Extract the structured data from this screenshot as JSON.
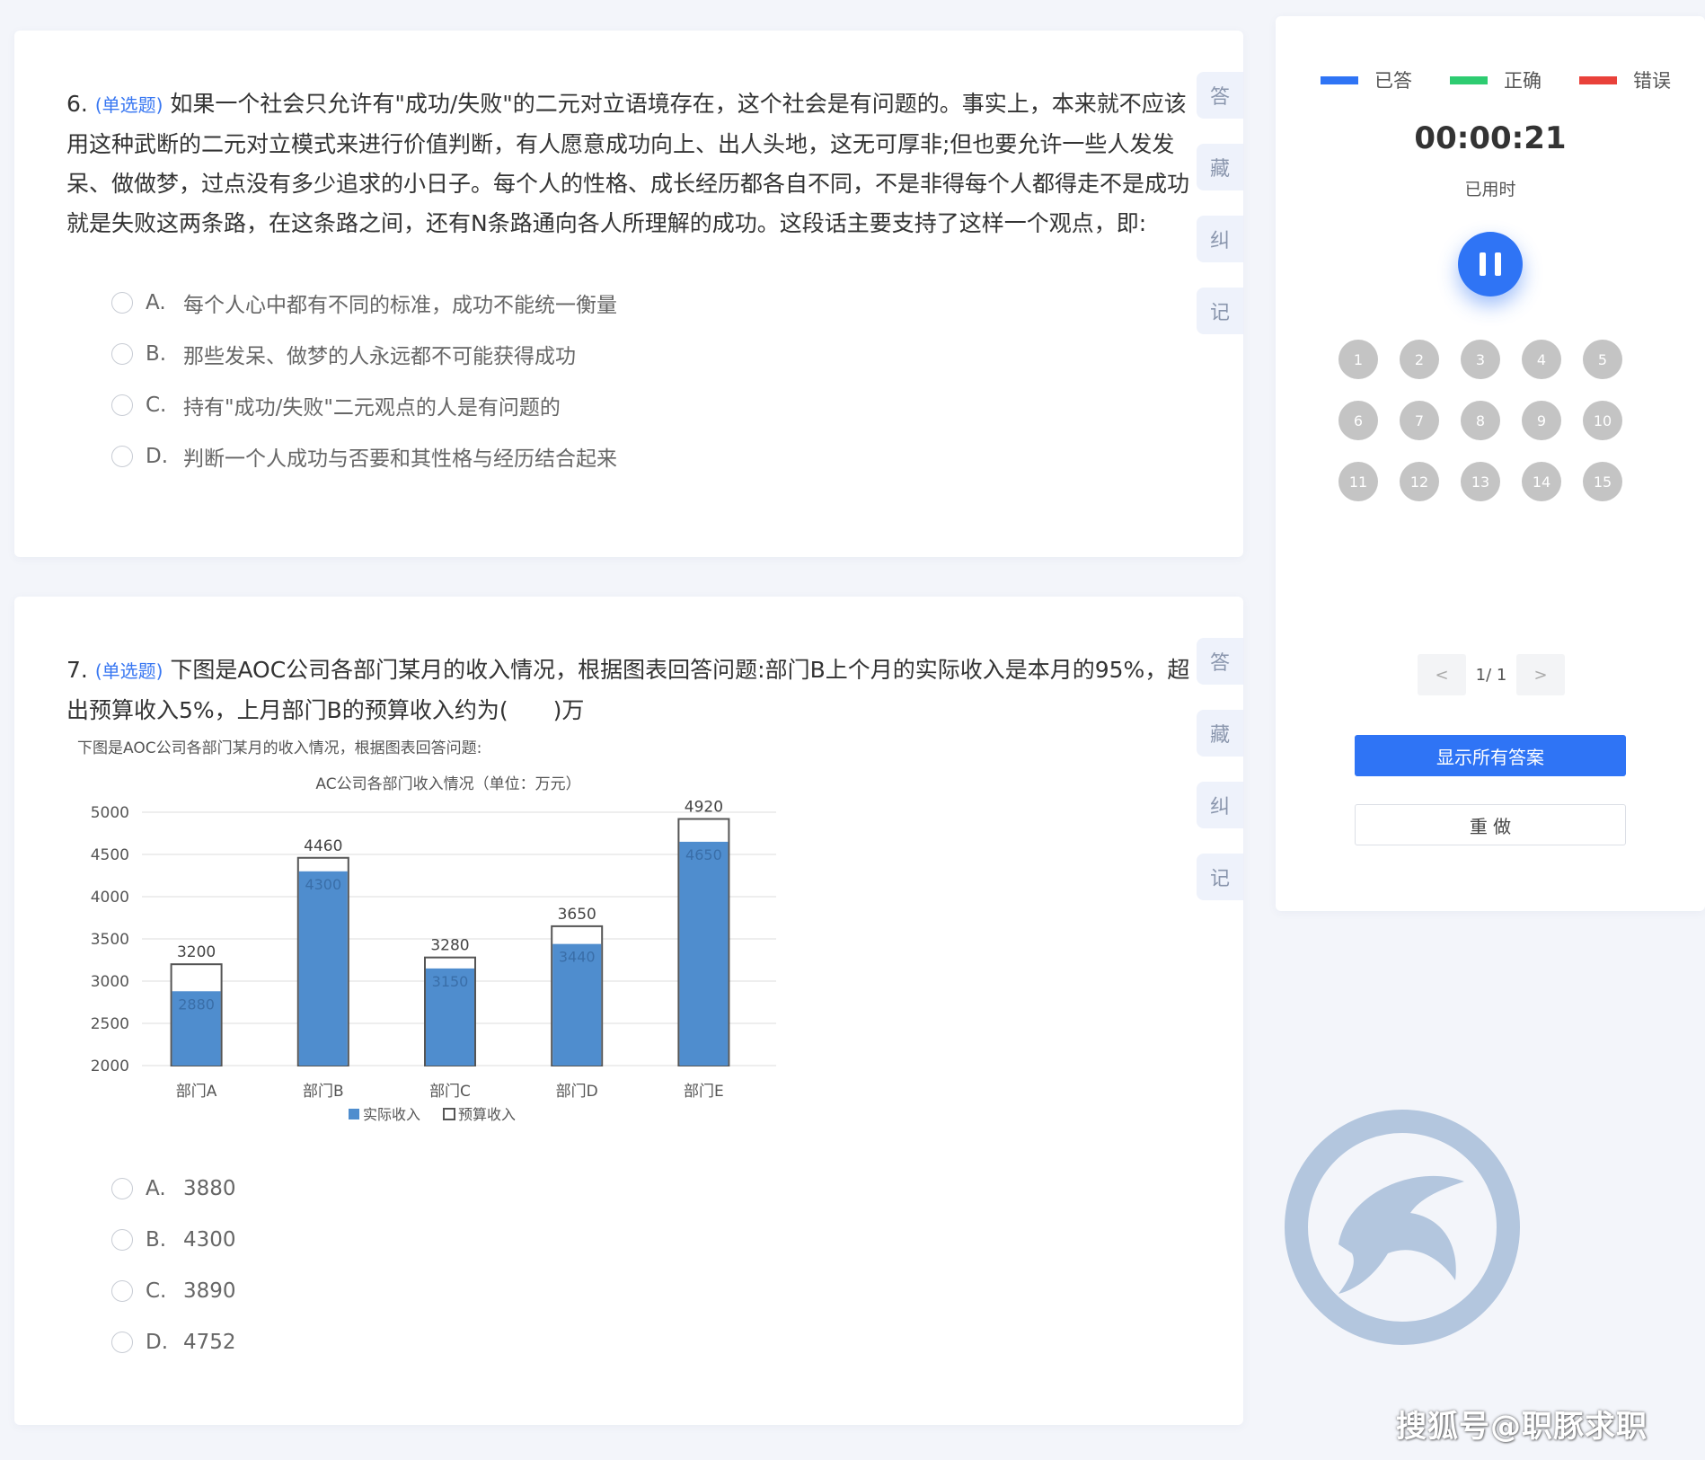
{
  "q6": {
    "number": "6.",
    "type": "(单选题)",
    "text": "如果一个社会只允许有\"成功/失败\"的二元对立语境存在，这个社会是有问题的。事实上，本来就不应该用这种武断的二元对立模式来进行价值判断，有人愿意成功向上、出人头地，这无可厚非;但也要允许一些人发发呆、做做梦，过点没有多少追求的小日子。每个人的性格、成长经历都各自不同，不是非得每个人都得走不是成功就是失败这两条路，在这条路之间，还有N条路通向各人所理解的成功。这段话主要支持了这样一个观点，即:",
    "options": [
      {
        "letter": "A.",
        "text": "每个人心中都有不同的标准，成功不能统一衡量"
      },
      {
        "letter": "B.",
        "text": "那些发呆、做梦的人永远都不可能获得成功"
      },
      {
        "letter": "C.",
        "text": "持有\"成功/失败\"二元观点的人是有问题的"
      },
      {
        "letter": "D.",
        "text": "判断一个人成功与否要和其性格与经历结合起来"
      }
    ]
  },
  "q7": {
    "number": "7.",
    "type": "(单选题)",
    "text": "下图是AOC公司各部门某月的收入情况，根据图表回答问题:部门B上个月的实际收入是本月的95%，超出预算收入5%，上月部门B的预算收入约为(　　)万",
    "options": [
      {
        "letter": "A.",
        "text": "3880"
      },
      {
        "letter": "B.",
        "text": "4300"
      },
      {
        "letter": "C.",
        "text": "3890"
      },
      {
        "letter": "D.",
        "text": "4752"
      }
    ]
  },
  "side_tabs": [
    "答",
    "藏",
    "纠",
    "记"
  ],
  "chart_data": {
    "type": "bar",
    "caption": "下图是AOC公司各部门某月的收入情况，根据图表回答问题:",
    "title": "AC公司各部门收入情况（单位：万元）",
    "categories": [
      "部门A",
      "部门B",
      "部门C",
      "部门D",
      "部门E"
    ],
    "series": [
      {
        "name": "实际收入",
        "values": [
          2880,
          4300,
          3150,
          3440,
          4650
        ]
      },
      {
        "name": "预算收入",
        "values": [
          3200,
          4460,
          3280,
          3650,
          4920
        ]
      }
    ],
    "yticks": [
      "2000",
      "2500",
      "3000",
      "3500",
      "4000",
      "4500",
      "5000"
    ],
    "ylim": [
      2000,
      5000
    ],
    "grid": true,
    "legend_position": "bottom-center",
    "colors": {
      "actual": "#4f8dce",
      "budget": "#ffffff"
    }
  },
  "sidebar": {
    "legend": [
      {
        "label": "已答",
        "color": "#2f74f5"
      },
      {
        "label": "正确",
        "color": "#2ecc71"
      },
      {
        "label": "错误",
        "color": "#e9413a"
      }
    ],
    "timer": "00:00:21",
    "timer_label": "已用时",
    "numbers": [
      "1",
      "2",
      "3",
      "4",
      "5",
      "6",
      "7",
      "8",
      "9",
      "10",
      "11",
      "12",
      "13",
      "14",
      "15"
    ],
    "pager": {
      "prev": "<",
      "text": "1/ 1",
      "next": ">"
    },
    "show_answers": "显示所有答案",
    "redo": "重 做"
  },
  "watermark": "搜狐号@职豚求职",
  "colors": {
    "accent": "#2f74f5",
    "logo": "#b3c6de"
  }
}
